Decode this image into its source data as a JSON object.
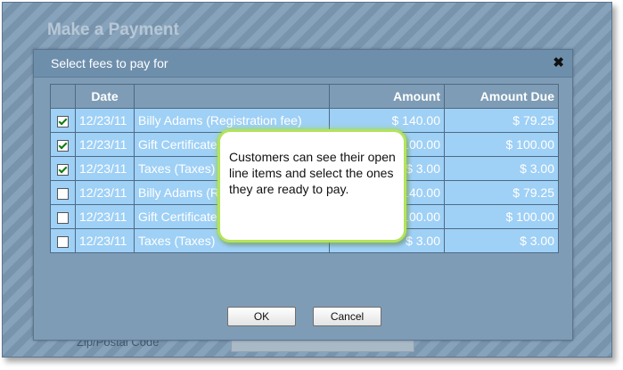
{
  "page": {
    "title": "Make a Payment",
    "bg_field_label": "Zip/Postal Code"
  },
  "dialog": {
    "title": "Select fees to pay for",
    "close_glyph": "✖",
    "ok_label": "OK",
    "cancel_label": "Cancel"
  },
  "table": {
    "headers": {
      "check": "",
      "date": "Date",
      "description": "",
      "amount": "Amount",
      "amount_due": "Amount Due"
    },
    "rows": [
      {
        "checked": true,
        "date": "12/23/11",
        "description": "Billy Adams (Registration fee)",
        "amount": "$ 140.00",
        "amount_due": "$ 79.25"
      },
      {
        "checked": true,
        "date": "12/23/11",
        "description": "Gift Certificate",
        "amount": "$ 100.00",
        "amount_due": "$ 100.00"
      },
      {
        "checked": true,
        "date": "12/23/11",
        "description": "Taxes (Taxes)",
        "amount": "$ 3.00",
        "amount_due": "$ 3.00"
      },
      {
        "checked": false,
        "date": "12/23/11",
        "description": "Billy Adams (Registration fee)",
        "amount": "$ 140.00",
        "amount_due": "$ 79.25"
      },
      {
        "checked": false,
        "date": "12/23/11",
        "description": "Gift Certificate",
        "amount": "$ 100.00",
        "amount_due": "$ 100.00"
      },
      {
        "checked": false,
        "date": "12/23/11",
        "description": "Taxes (Taxes)",
        "amount": "$ 3.00",
        "amount_due": "$ 3.00"
      }
    ]
  },
  "callout": {
    "text": "Customers can see their open line items and select the ones they are ready to pay."
  },
  "colors": {
    "overlay": "#7e9cb6",
    "row_bg": "#9fd0f6",
    "callout_border": "#b4e35a",
    "check_mark": "#0b7a0b"
  },
  "icons": {
    "close": "close-icon",
    "check": "checkmark-icon"
  }
}
